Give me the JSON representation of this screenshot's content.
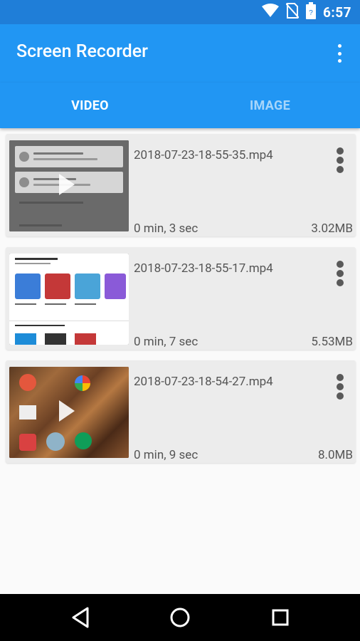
{
  "status_bar": {
    "time": "6:57"
  },
  "app_bar": {
    "title": "Screen Recorder"
  },
  "tabs": [
    {
      "label": "VIDEO",
      "selected": true
    },
    {
      "label": "IMAGE",
      "selected": false
    }
  ],
  "recordings": [
    {
      "file_name": "2018-07-23-18-55-35.mp4",
      "duration": "0 min, 3 sec",
      "size": "3.02MB"
    },
    {
      "file_name": "2018-07-23-18-55-17.mp4",
      "duration": "0 min, 7 sec",
      "size": "5.53MB"
    },
    {
      "file_name": "2018-07-23-18-54-27.mp4",
      "duration": "0 min, 9 sec",
      "size": "8.0MB"
    }
  ],
  "colors": {
    "primary": "#2196f3",
    "primary_dark": "#1f7ed8",
    "card": "#ececec",
    "text_secondary": "#555555"
  }
}
